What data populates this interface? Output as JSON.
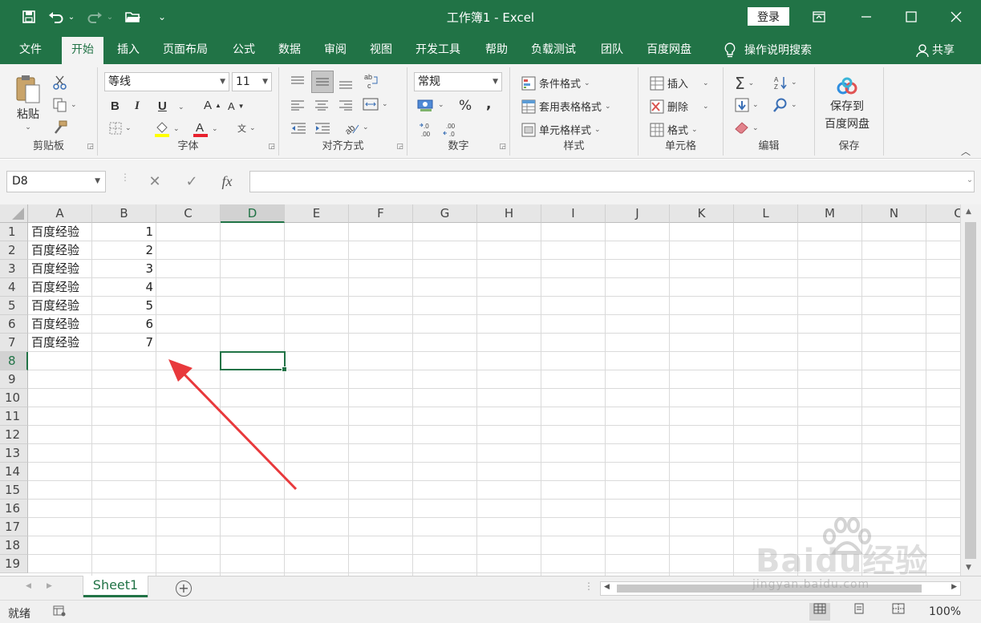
{
  "titlebar": {
    "title": "工作簿1  -  Excel",
    "login_label": "登录",
    "save_icon": "💾",
    "undo_icon": "↶",
    "redo_icon": "↷",
    "open_icon": "📂",
    "more_icon": "⌄"
  },
  "tabs": [
    "文件",
    "开始",
    "插入",
    "页面布局",
    "公式",
    "数据",
    "审阅",
    "视图",
    "开发工具",
    "帮助",
    "负载测试",
    "团队",
    "百度网盘"
  ],
  "tell_me": "操作说明搜索",
  "share": "共享",
  "ribbon": {
    "clipboard": {
      "paste": "粘贴",
      "label": "剪贴板"
    },
    "font": {
      "name": "等线",
      "size": "11",
      "bold": "B",
      "italic": "I",
      "underline": "U",
      "grow": "A",
      "shrink": "A",
      "label": "字体"
    },
    "align": {
      "label": "对齐方式"
    },
    "number": {
      "format": "常规",
      "percent": "%",
      "comma": "9",
      "label": "数字"
    },
    "styles": {
      "conditional": "条件格式",
      "table": "套用表格格式",
      "cell": "单元格样式",
      "label": "样式"
    },
    "cells": {
      "insert": "插入",
      "delete": "删除",
      "format": "格式",
      "label": "单元格"
    },
    "editing": {
      "label": "编辑"
    },
    "save": {
      "line1": "保存到",
      "line2": "百度网盘",
      "label": "保存"
    }
  },
  "formula": {
    "namebox": "D8",
    "cancel": "✕",
    "enter": "✓",
    "fx": "fx",
    "value": ""
  },
  "sheet": {
    "columns": [
      "A",
      "B",
      "C",
      "D",
      "E",
      "F",
      "G",
      "H",
      "I",
      "J",
      "K",
      "L",
      "M",
      "N",
      "C"
    ],
    "rows": [
      "1",
      "2",
      "3",
      "4",
      "5",
      "6",
      "7",
      "8",
      "9",
      "10",
      "11",
      "12",
      "13",
      "14",
      "15",
      "16",
      "17",
      "18",
      "19"
    ],
    "a_values": [
      "百度经验",
      "百度经验",
      "百度经验",
      "百度经验",
      "百度经验",
      "百度经验",
      "百度经验"
    ],
    "b_values": [
      "1",
      "2",
      "3",
      "4",
      "5",
      "6",
      "7"
    ],
    "active_cell": "D8"
  },
  "sheet_tabs": {
    "name": "Sheet1",
    "add": "+"
  },
  "status": {
    "ready": "就绪",
    "zoom": "100%"
  },
  "watermark": {
    "brand": "Baidu经验",
    "url": "jingyan.baidu.com"
  },
  "colors": {
    "accent": "#217346",
    "arrow": "#e8393c"
  }
}
